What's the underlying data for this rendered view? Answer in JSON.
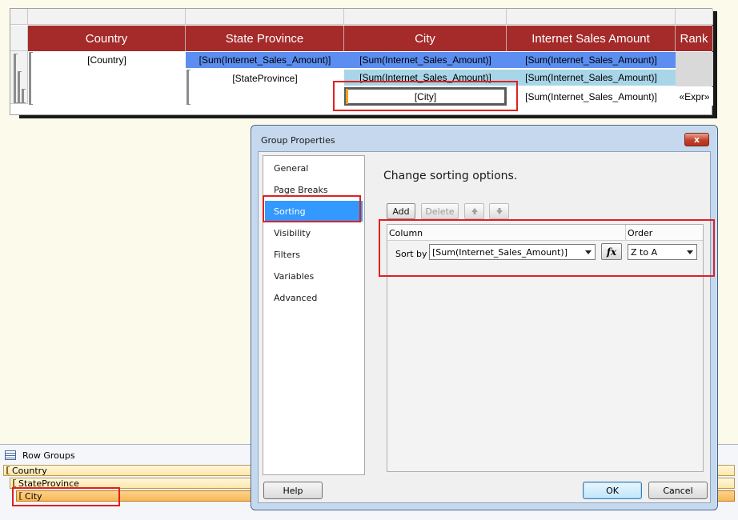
{
  "tablix": {
    "headers": [
      "Country",
      "State Province",
      "City",
      "Internet Sales Amount",
      "Rank"
    ],
    "row1": {
      "country": "[Country]",
      "sum": "[Sum(Internet_Sales_Amount)]",
      "sum_city": "[Sum(Internet_Sales_Amount)]",
      "sum_amount": "[Sum(Internet_Sales_Amount)]"
    },
    "row2": {
      "state": "[StateProvince]",
      "sum_city": "[Sum(Internet_Sales_Amount)]",
      "sum_amount": "[Sum(Internet_Sales_Amount)]"
    },
    "row3": {
      "city": "[City]",
      "sum_amount": "[Sum(Internet_Sales_Amount)]",
      "rank": "«Expr»"
    }
  },
  "row_groups": {
    "title": "Row Groups",
    "items": [
      "Country",
      "StateProvince",
      "City"
    ],
    "selected": "City"
  },
  "dialog": {
    "title": "Group Properties",
    "close_label": "x",
    "nav": [
      "General",
      "Page Breaks",
      "Sorting",
      "Visibility",
      "Filters",
      "Variables",
      "Advanced"
    ],
    "active_nav": "Sorting",
    "heading": "Change sorting options.",
    "toolbar": {
      "add": "Add",
      "delete": "Delete"
    },
    "grid": {
      "col_column": "Column",
      "col_order": "Order",
      "row_label": "Sort by",
      "sort_by": "[Sum(Internet_Sales_Amount)]",
      "fx": "fx",
      "order": "Z to A"
    },
    "help": "Help",
    "ok": "OK",
    "cancel": "Cancel"
  },
  "colors": {
    "header_red": "#a52a2a",
    "selection_blue": "#3399ff",
    "highlight_red": "#e02020"
  }
}
